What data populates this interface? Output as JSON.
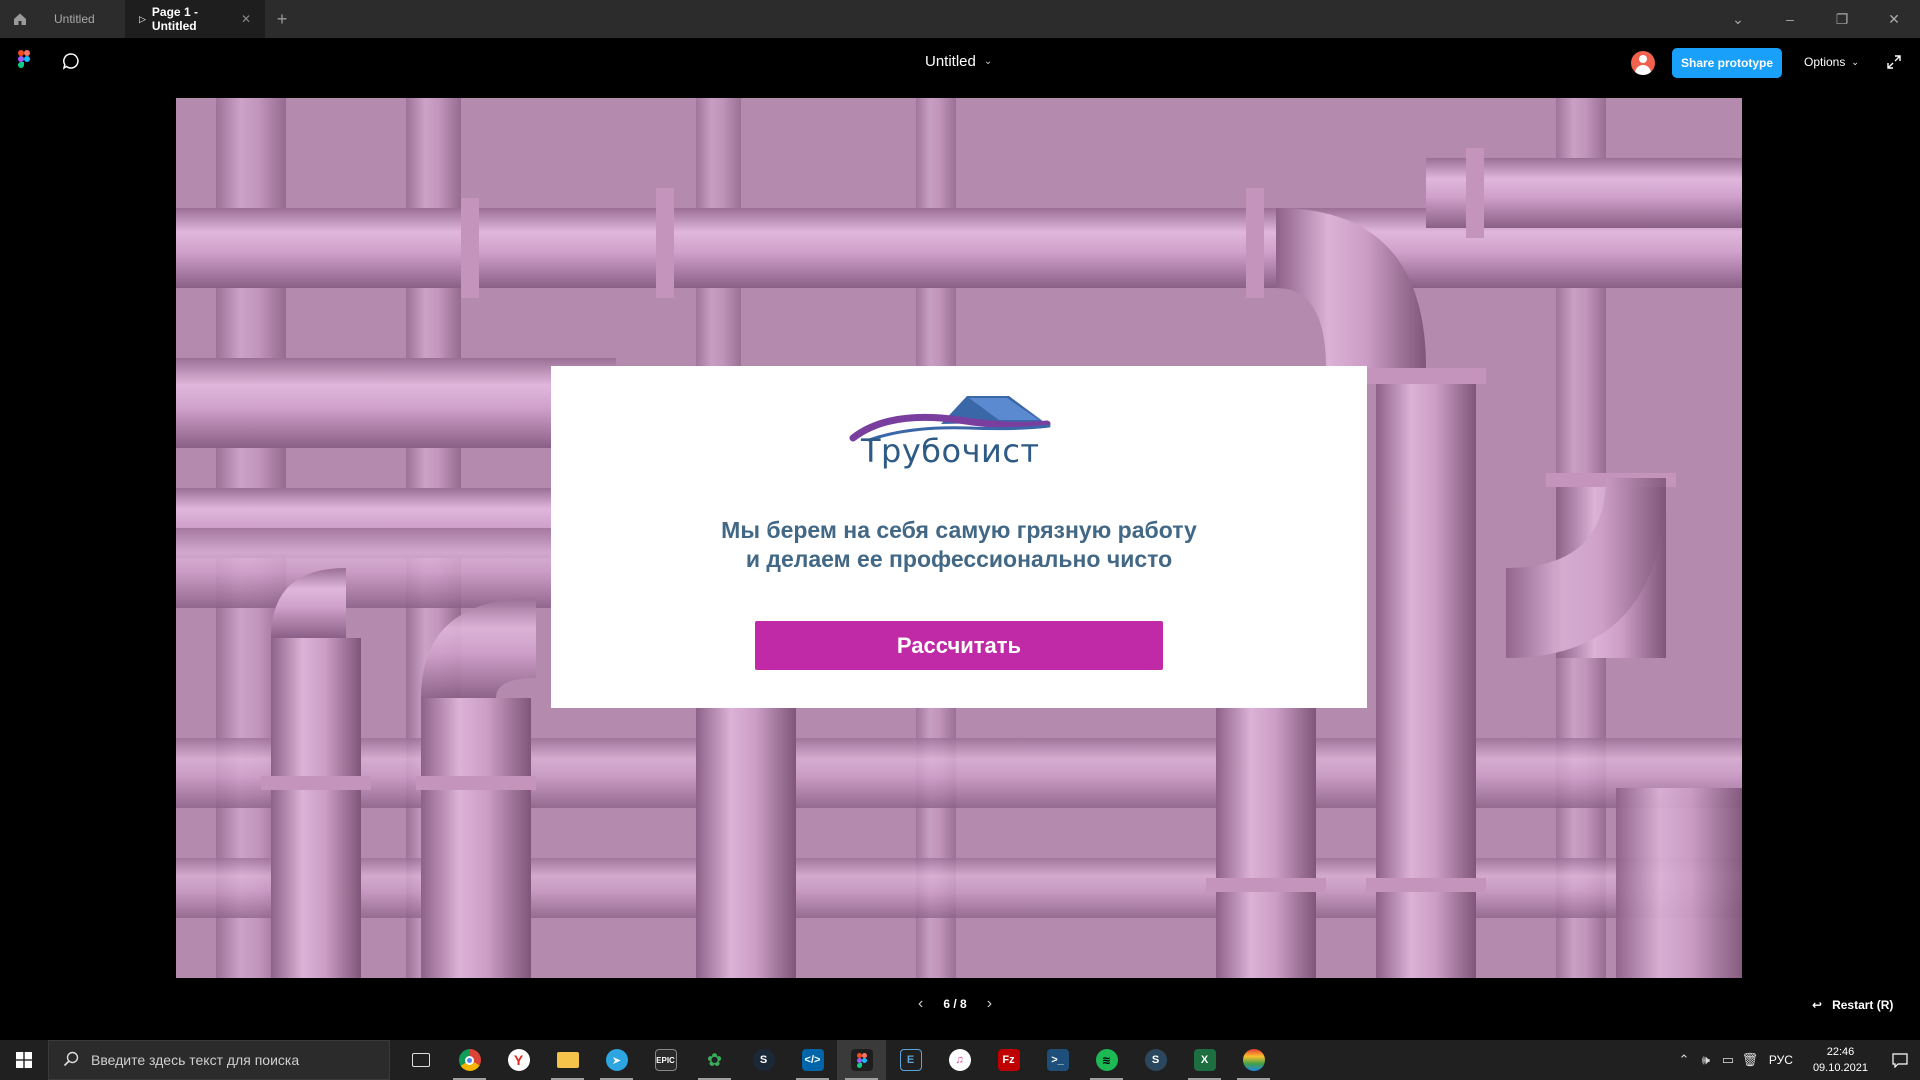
{
  "tabs": [
    {
      "label": "Untitled",
      "active": false
    },
    {
      "label": "Page 1 - Untitled",
      "active": true
    }
  ],
  "toolbar": {
    "doc_title": "Untitled",
    "share_label": "Share prototype",
    "options_label": "Options",
    "share_color": "#18a0fb"
  },
  "slide": {
    "logo_text": "Трубочист",
    "tagline_line1": "Мы берем на себя самую грязную работу",
    "tagline_line2": "и делаем ее профессионально чисто",
    "button_label": "Рассчитать",
    "button_color": "#c02aa6",
    "background_tint": "#b98bb3"
  },
  "pager": {
    "label": "6 / 8",
    "restart_label": "Restart (R)"
  },
  "taskbar": {
    "search_placeholder": "Введите здесь текст для поиска",
    "apps": [
      "task-view",
      "chrome",
      "yandex",
      "file-explorer",
      "telegram",
      "epic-games",
      "chia",
      "steam",
      "vscode",
      "figma",
      "editor",
      "itunes",
      "filezilla",
      "terminal",
      "spotify",
      "steam",
      "excel",
      "ball"
    ],
    "language": "РУС",
    "time": "22:46",
    "date": "09.10.2021"
  }
}
